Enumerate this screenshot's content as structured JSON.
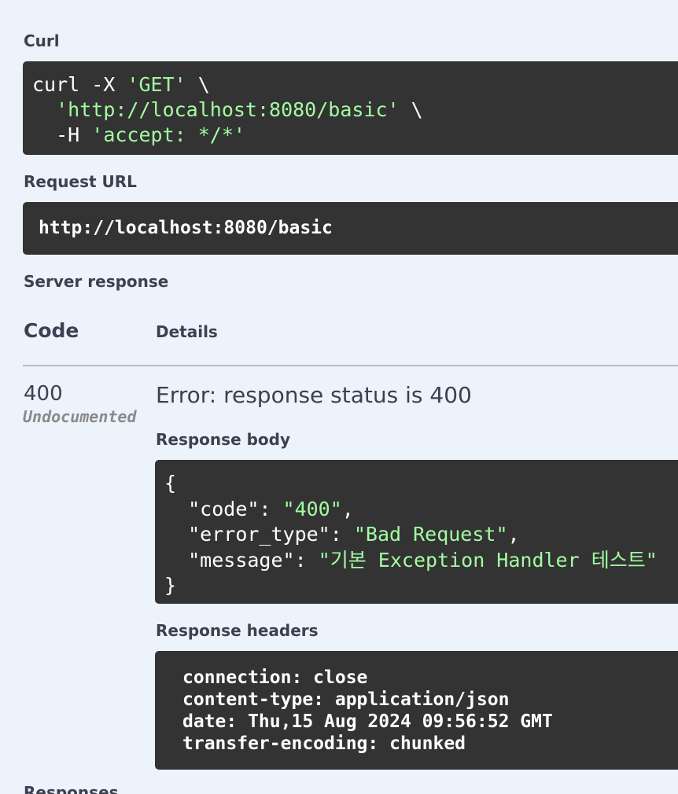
{
  "curl": {
    "label": "Curl",
    "lines": [
      {
        "plain": "curl -X ",
        "str": "'GET'",
        "tail": " \\"
      },
      {
        "plain": "  ",
        "str": "'http://localhost:8080/basic'",
        "tail": " \\"
      },
      {
        "plain": "  -H ",
        "str": "'accept: */*'",
        "tail": ""
      }
    ]
  },
  "request_url": {
    "label": "Request URL",
    "value": "http://localhost:8080/basic"
  },
  "server_response": {
    "label": "Server response",
    "col_code": "Code",
    "col_details": "Details",
    "code": "400",
    "code_note": "Undocumented",
    "error_message": "Error: response status is 400",
    "body_label": "Response body",
    "body": {
      "open": "{",
      "fields": [
        {
          "key": "\"code\"",
          "value": "\"400\"",
          "sep": ","
        },
        {
          "key": "\"error_type\"",
          "value": "\"Bad Request\"",
          "sep": ","
        },
        {
          "key": "\"message\"",
          "value": "\"기본 Exception Handler 테스트\"",
          "sep": ""
        }
      ],
      "close": "}"
    },
    "headers_label": "Response headers",
    "headers": [
      "connection: close",
      "content-type: application/json",
      "date: Thu,15 Aug 2024 09:56:52 GMT",
      "transfer-encoding: chunked"
    ]
  },
  "responses_label": "Responses",
  "colors": {
    "background": "#ecf3fb",
    "code_block": "#333333",
    "string_green": "#a2fca2",
    "text": "#3b4151",
    "undocumented": "#8a8a8a"
  }
}
